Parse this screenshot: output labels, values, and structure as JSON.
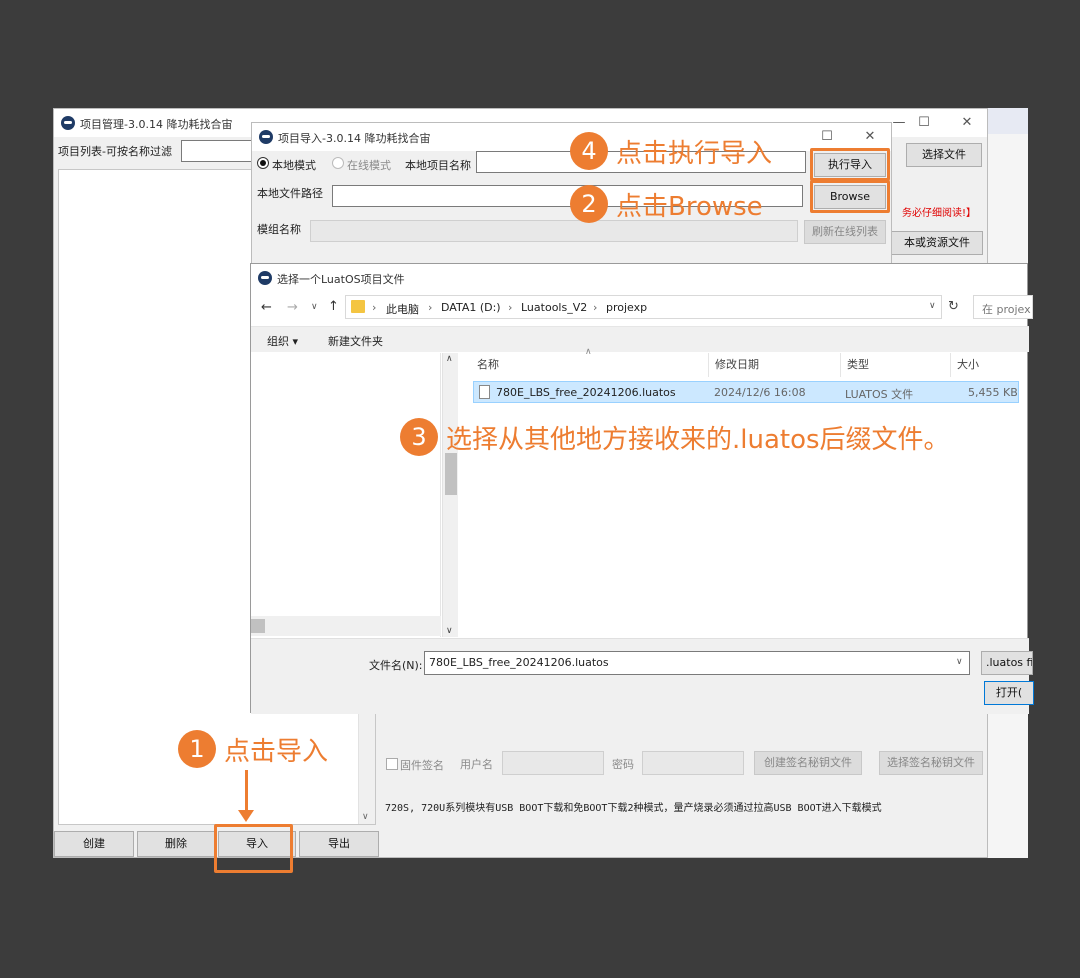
{
  "main_window": {
    "title": "项目管理-3.0.14 降功耗找合宙",
    "filter_label": "项目列表-可按名称过滤",
    "buttons": {
      "create": "创建",
      "delete": "删除",
      "import": "导入",
      "export": "导出"
    },
    "right": {
      "select_file": "选择文件",
      "notice": "务必仔细阅读!】",
      "script_or_resource": "本或资源文件",
      "firmware_sign": "固件签名",
      "username": "用户名",
      "password": "密码",
      "create_sign_key": "创建签名秘钥文件",
      "select_sign_key": "选择签名秘钥文件",
      "usb_note": "720S, 720U系列模块有USB BOOT下载和免BOOT下载2种模式，量产烧录必须通过拉高USB BOOT进入下载模式"
    }
  },
  "import_window": {
    "title": "项目导入-3.0.14 降功耗找合宙",
    "local_mode": "本地模式",
    "online_mode": "在线模式",
    "local_project_name": "本地项目名称",
    "execute_import": "执行导入",
    "local_file_path": "本地文件路径",
    "browse": "Browse",
    "module_name": "模组名称",
    "refresh_online": "刷新在线列表"
  },
  "file_dialog": {
    "title": "选择一个LuatOS项目文件",
    "breadcrumb": [
      "此电脑",
      "DATA1 (D:)",
      "Luatools_V2",
      "projexp"
    ],
    "search_placeholder": "在 projex",
    "organize": "组织 ▾",
    "new_folder": "新建文件夹",
    "columns": [
      "名称",
      "修改日期",
      "类型",
      "大小"
    ],
    "files": [
      {
        "name": "780E_LBS_free_20241206.luatos",
        "date": "2024/12/6 16:08",
        "type": "LUATOS 文件",
        "size": "5,455 KB"
      }
    ],
    "filename_label": "文件名(N):",
    "filename_value": "780E_LBS_free_20241206.luatos",
    "filter": ".luatos fi",
    "open": "打开("
  },
  "annotations": [
    {
      "num": "1",
      "text": "点击导入"
    },
    {
      "num": "2",
      "text": "点击Browse"
    },
    {
      "num": "3",
      "text": "选择从其他地方接收来的.luatos后缀文件。"
    },
    {
      "num": "4",
      "text": "点击执行导入"
    }
  ],
  "colors": {
    "accent": "#ed7d31",
    "background": "#3c3c3c",
    "selection": "#cce8ff"
  }
}
